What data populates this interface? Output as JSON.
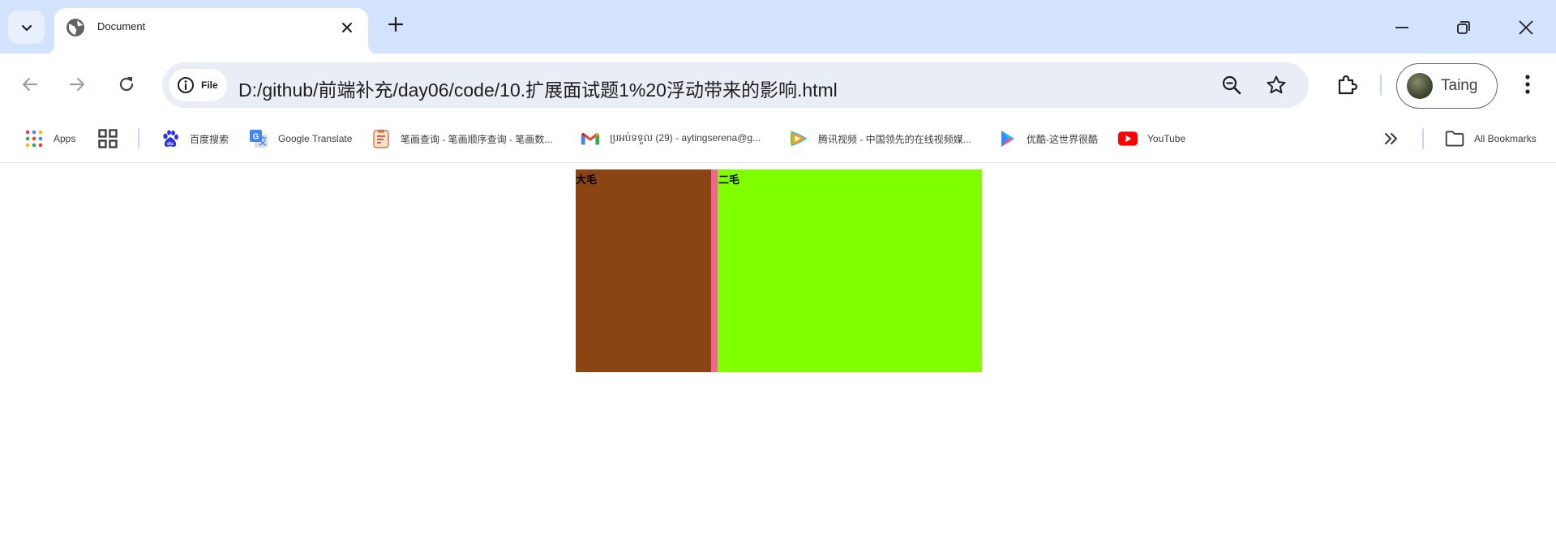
{
  "tab": {
    "title": "Document"
  },
  "address_bar": {
    "site_chip_label": "File",
    "url": "D:/github/前端补充/day06/code/10.扩展面试题1%20浮动带来的影响.html"
  },
  "profile": {
    "name": "Taing"
  },
  "bookmarks": {
    "items": [
      {
        "label": "Apps",
        "icon": "apps-grid-icon"
      },
      {
        "label": "",
        "icon": "tab-groups-icon"
      },
      {
        "label": "百度搜索",
        "icon": "baidu-icon"
      },
      {
        "label": "Google Translate",
        "icon": "google-translate-icon"
      },
      {
        "label": "笔画查询 - 笔画顺序查询 - 笔画数...",
        "icon": "stroke-order-icon"
      },
      {
        "label": "ប្រអប់ទទួល (29) - aytingserena@g...",
        "icon": "gmail-icon"
      },
      {
        "label": "腾讯视频 - 中国领先的在线视频媒...",
        "icon": "tencent-video-icon"
      },
      {
        "label": "优酷-这世界很酷",
        "icon": "youku-icon"
      },
      {
        "label": "YouTube",
        "icon": "youtube-icon"
      }
    ],
    "all_bookmarks_label": "All Bookmarks"
  },
  "page": {
    "box1_text": "大毛",
    "box2_text": "二毛"
  },
  "colors": {
    "tabstrip": "#d3e3fd",
    "box1": "#8b4513",
    "gap": "#f06595",
    "box2": "#7fff00"
  }
}
